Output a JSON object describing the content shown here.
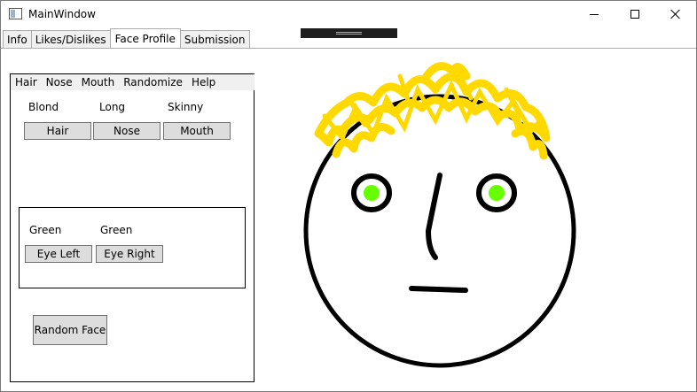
{
  "window": {
    "title": "MainWindow",
    "icon": "app-window-icon",
    "controls": {
      "minimize": "minimize-icon",
      "maximize": "maximize-icon",
      "close": "close-icon"
    }
  },
  "tabs": [
    {
      "label": "Info",
      "active": false
    },
    {
      "label": "Likes/Dislikes",
      "active": false
    },
    {
      "label": "Face Profile",
      "active": true
    },
    {
      "label": "Submission",
      "active": false
    }
  ],
  "menu": [
    "Hair",
    "Nose",
    "Mouth",
    "Randomize",
    "Help"
  ],
  "features": {
    "hair_value": "Blond",
    "nose_value": "Long",
    "mouth_value": "Skinny",
    "hair_button": "Hair",
    "nose_button": "Nose",
    "mouth_button": "Mouth"
  },
  "eyes": {
    "left_value": "Green",
    "right_value": "Green",
    "left_button": "Eye Left",
    "right_button": "Eye Right"
  },
  "random_face_button": "Random Face",
  "face": {
    "hair_color": "#ffd900",
    "eye_color": "#66ff00",
    "outline_color": "#000000"
  }
}
